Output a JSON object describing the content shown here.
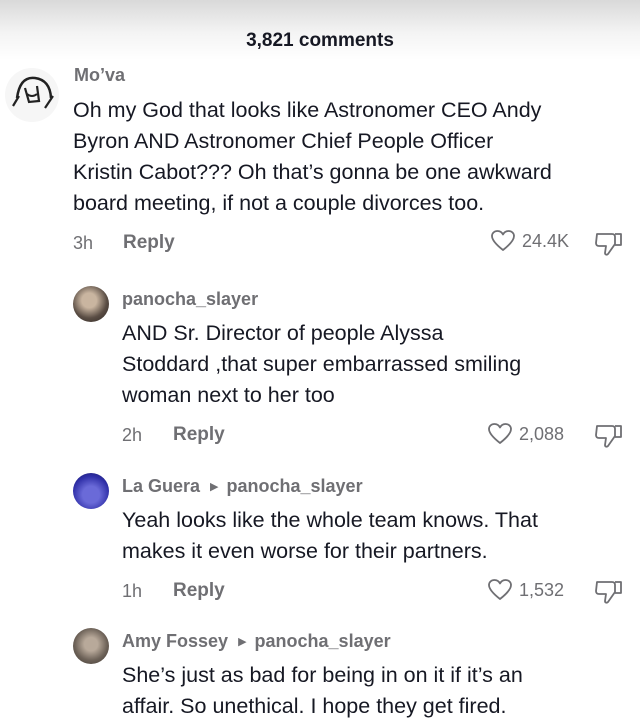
{
  "header": {
    "title": "3,821 comments"
  },
  "comments": [
    {
      "username": "Mo’va",
      "reply_to": "",
      "lines": [
        "Oh my God that looks like Astronomer CEO Andy",
        "Byron AND Astronomer Chief People Officer",
        "Kristin Cabot??? Oh that’s gonna be one awkward",
        "board meeting, if not a couple divorces too."
      ],
      "time": "3h",
      "reply_label": "Reply",
      "likes": "24.4K"
    },
    {
      "username": "panocha_slayer",
      "reply_to": "",
      "lines": [
        "AND Sr. Director of people Alyssa",
        "Stoddard ,that super embarrassed smiling",
        "woman next to her too"
      ],
      "time": "2h",
      "reply_label": "Reply",
      "likes": "2,088"
    },
    {
      "username": "La Guera",
      "reply_to": "panocha_slayer",
      "lines": [
        "Yeah looks like the whole team knows. That",
        "makes it even worse for their partners."
      ],
      "time": "1h",
      "reply_label": "Reply",
      "likes": "1,532"
    },
    {
      "username": "Amy Fossey",
      "reply_to": "panocha_slayer",
      "lines": [
        "She’s just as bad for being in on it if it’s an",
        "affair. So unethical. I hope they get fired."
      ],
      "time": "",
      "reply_label": "",
      "likes": ""
    }
  ],
  "icons": {
    "like": "heart-outline-icon",
    "dislike": "thumbs-down-outline-icon",
    "reply_arrow": "triangle-right-icon"
  },
  "colors": {
    "text_primary": "#161823",
    "text_secondary": "#6f6f73"
  }
}
